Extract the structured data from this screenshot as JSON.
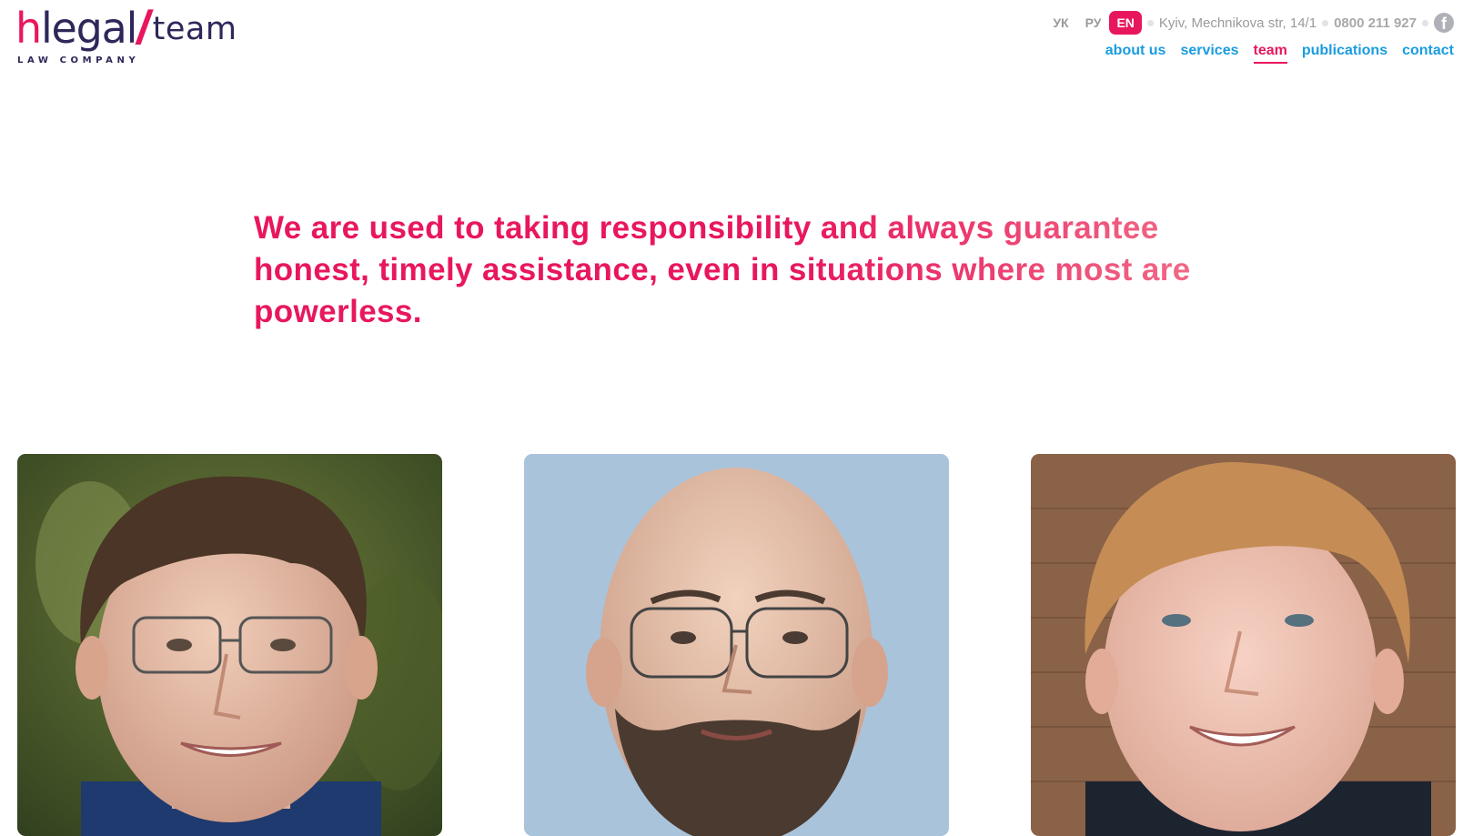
{
  "logo": {
    "h": "h",
    "legal": "legal",
    "slash": "/",
    "team": "team",
    "subtitle": "LAW COMPANY"
  },
  "topbar": {
    "languages": [
      {
        "label": "УК",
        "active": false
      },
      {
        "label": "РУ",
        "active": false
      },
      {
        "label": "EN",
        "active": true
      }
    ],
    "address": "Kyiv, Mechnikova str, 14/1",
    "phone": "0800 211 927",
    "social_icon": "facebook-icon"
  },
  "nav": {
    "items": [
      {
        "label": "about us",
        "active": false
      },
      {
        "label": "services",
        "active": false
      },
      {
        "label": "team",
        "active": true
      },
      {
        "label": "publications",
        "active": false
      },
      {
        "label": "contact",
        "active": false
      }
    ]
  },
  "hero": {
    "headline": "We are used to taking responsibility and always guarantee honest, timely assistance, even in situations where most are powerless."
  },
  "colors": {
    "brand_pink": "#e8175d",
    "brand_navy": "#2d2859",
    "link_blue": "#1a9ce0"
  }
}
